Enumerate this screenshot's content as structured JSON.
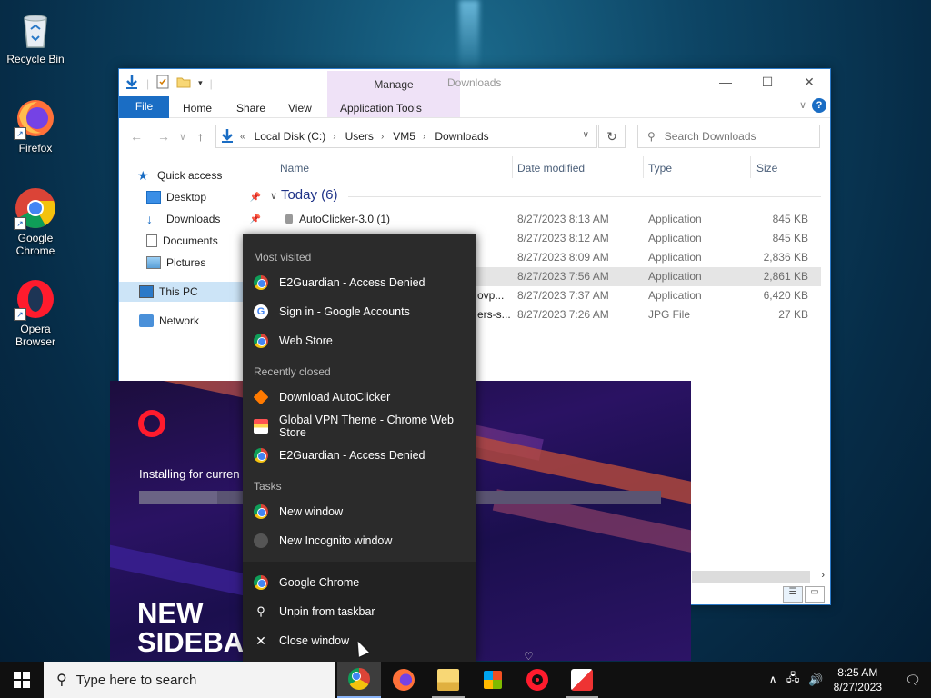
{
  "desktop": {
    "icons": [
      {
        "label": "Recycle Bin",
        "icon": "recycle-bin-icon"
      },
      {
        "label": "Firefox",
        "icon": "firefox-icon"
      },
      {
        "label": "Google Chrome",
        "icon": "chrome-icon"
      },
      {
        "label": "Opera Browser",
        "icon": "opera-icon"
      }
    ]
  },
  "explorer": {
    "title": "Downloads",
    "ribbon": {
      "file": "File",
      "home": "Home",
      "share": "Share",
      "view": "View",
      "manage": "Manage",
      "app_tools": "Application Tools"
    },
    "address": {
      "crumbs": [
        "Local Disk (C:)",
        "Users",
        "VM5",
        "Downloads"
      ]
    },
    "search_placeholder": "Search Downloads",
    "nav": {
      "quick_access": "Quick access",
      "desktop": "Desktop",
      "downloads": "Downloads",
      "documents": "Documents",
      "pictures": "Pictures",
      "this_pc": "This PC",
      "network": "Network"
    },
    "columns": {
      "name": "Name",
      "date": "Date modified",
      "type": "Type",
      "size": "Size"
    },
    "group": "Today (6)",
    "files": [
      {
        "name": "AutoClicker-3.0 (1)",
        "date": "8/27/2023 8:13 AM",
        "type": "Application",
        "size": "845 KB"
      },
      {
        "name": "",
        "date": "8/27/2023 8:12 AM",
        "type": "Application",
        "size": "845 KB"
      },
      {
        "name": "",
        "date": "8/27/2023 8:09 AM",
        "type": "Application",
        "size": "2,836 KB"
      },
      {
        "name": "",
        "date": "8/27/2023 7:56 AM",
        "type": "Application",
        "size": "2,861 KB"
      },
      {
        "name": "ovp...",
        "date": "8/27/2023 7:37 AM",
        "type": "Application",
        "size": "6,420 KB"
      },
      {
        "name": "ers-s...",
        "date": "8/27/2023 7:26 AM",
        "type": "JPG File",
        "size": "27 KB"
      }
    ]
  },
  "opera_installer": {
    "installing": "Installing for curren",
    "headline_1": "NEW",
    "headline_2": "SIDEBA",
    "progress": 0.15
  },
  "jumplist": {
    "most_visited_title": "Most visited",
    "most_visited": [
      {
        "label": "E2Guardian - Access Denied",
        "icon": "chrome-icon"
      },
      {
        "label": "Sign in - Google Accounts",
        "icon": "google-icon"
      },
      {
        "label": "Web Store",
        "icon": "chrome-icon"
      }
    ],
    "recently_closed_title": "Recently closed",
    "recently_closed": [
      {
        "label": "Download AutoClicker",
        "icon": "autoclicker-icon"
      },
      {
        "label": "Global VPN Theme - Chrome Web Store",
        "icon": "web-store-icon"
      },
      {
        "label": "E2Guardian - Access Denied",
        "icon": "chrome-icon"
      }
    ],
    "tasks_title": "Tasks",
    "tasks": [
      {
        "label": "New window",
        "icon": "chrome-icon"
      },
      {
        "label": "New Incognito window",
        "icon": "incognito-icon"
      }
    ],
    "actions": [
      {
        "label": "Google Chrome",
        "icon": "chrome-icon"
      },
      {
        "label": "Unpin from taskbar",
        "icon": "unpin-icon"
      },
      {
        "label": "Close window",
        "icon": "close-icon"
      }
    ]
  },
  "taskbar": {
    "search_placeholder": "Type here to search",
    "time": "8:25 AM",
    "date": "8/27/2023"
  }
}
